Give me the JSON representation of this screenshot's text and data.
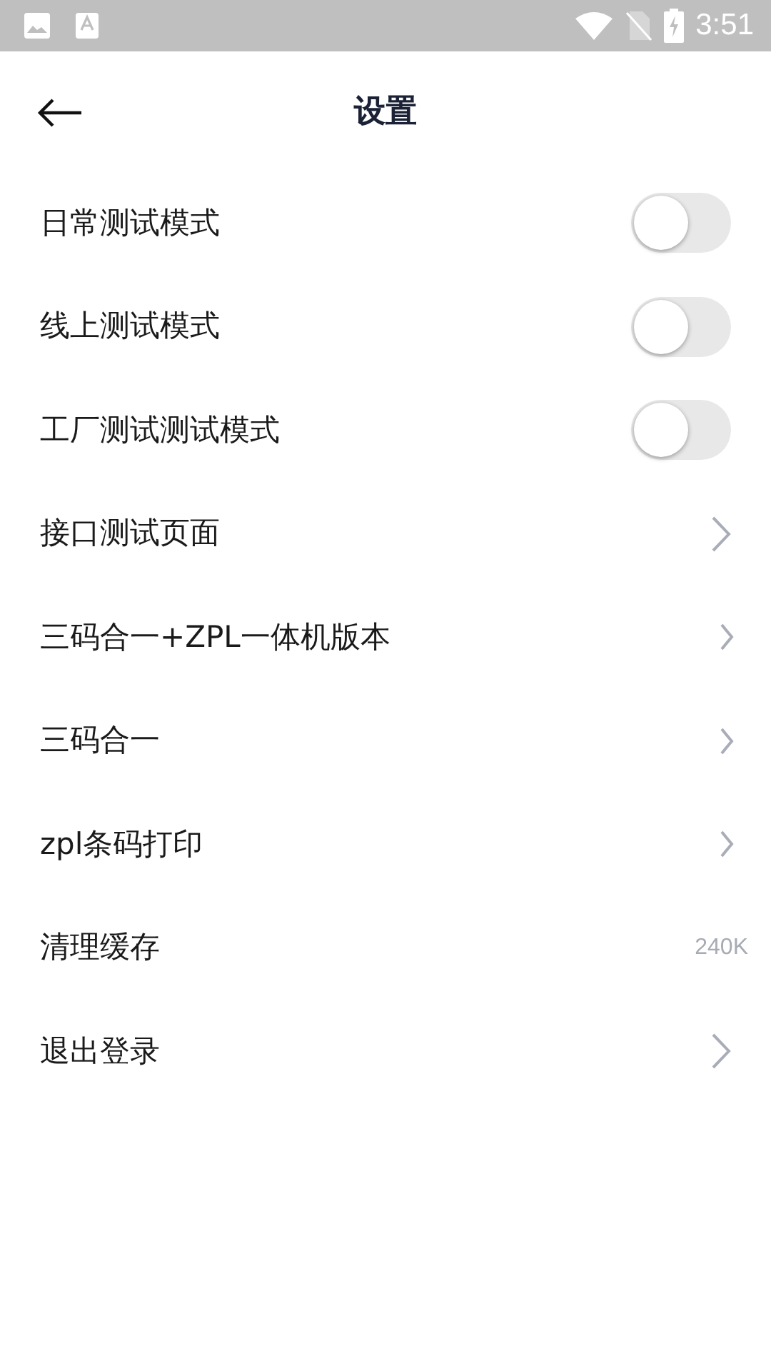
{
  "status_bar": {
    "time": "3:51"
  },
  "header": {
    "title": "设置"
  },
  "items": [
    {
      "kind": "toggle",
      "label": "日常测试模式",
      "on": false
    },
    {
      "kind": "toggle",
      "label": "线上测试模式",
      "on": false
    },
    {
      "kind": "toggle",
      "label": "工厂测试测试模式",
      "on": false
    },
    {
      "kind": "page",
      "label": "接口测试页面"
    },
    {
      "kind": "link",
      "label": "三码合一+ZPL一体机版本"
    },
    {
      "kind": "link",
      "label": "三码合一"
    },
    {
      "kind": "link",
      "label": "zpl条码打印"
    },
    {
      "kind": "value",
      "label": "清理缓存",
      "value": "240K"
    },
    {
      "kind": "page",
      "label": "退出登录"
    }
  ]
}
